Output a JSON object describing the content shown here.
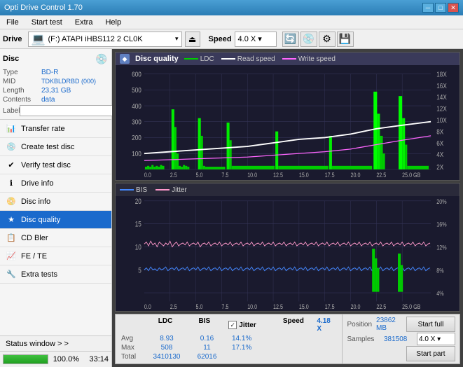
{
  "titlebar": {
    "title": "Opti Drive Control 1.70",
    "min": "─",
    "max": "□",
    "close": "✕"
  },
  "menubar": {
    "items": [
      "File",
      "Start test",
      "Extra",
      "Help"
    ]
  },
  "drive_toolbar": {
    "drive_label": "Drive",
    "drive_value": "(F:)  ATAPI iHBS112  2 CL0K",
    "speed_label": "Speed",
    "speed_value": "4.0 X  ▾"
  },
  "disc_panel": {
    "header": "Disc",
    "rows": [
      {
        "key": "Type",
        "val": "BD-R",
        "blue": true
      },
      {
        "key": "MID",
        "val": "TDKBLDRBD (000)",
        "blue": true
      },
      {
        "key": "Length",
        "val": "23,31 GB",
        "blue": true
      },
      {
        "key": "Contents",
        "val": "data",
        "blue": true
      }
    ],
    "label_key": "Label"
  },
  "nav": {
    "items": [
      {
        "id": "transfer-rate",
        "icon": "📊",
        "label": "Transfer rate",
        "active": false
      },
      {
        "id": "create-test-disc",
        "icon": "💿",
        "label": "Create test disc",
        "active": false
      },
      {
        "id": "verify-test-disc",
        "icon": "✔",
        "label": "Verify test disc",
        "active": false
      },
      {
        "id": "drive-info",
        "icon": "ℹ",
        "label": "Drive info",
        "active": false
      },
      {
        "id": "disc-info",
        "icon": "📀",
        "label": "Disc info",
        "active": false
      },
      {
        "id": "disc-quality",
        "icon": "★",
        "label": "Disc quality",
        "active": true
      },
      {
        "id": "cd-bler",
        "icon": "🔢",
        "label": "CD Bler",
        "active": false
      },
      {
        "id": "fe-te",
        "icon": "📈",
        "label": "FE / TE",
        "active": false
      },
      {
        "id": "extra-tests",
        "icon": "🔧",
        "label": "Extra tests",
        "active": false
      }
    ]
  },
  "status": {
    "window_label": "Status window > >",
    "progress_pct": 100,
    "progress_text": "100.0%",
    "time_text": "33:14"
  },
  "chart1": {
    "title": "Disc quality",
    "legend": [
      {
        "label": "LDC",
        "color": "#00cc00"
      },
      {
        "label": "Read speed",
        "color": "#ffffff"
      },
      {
        "label": "Write speed",
        "color": "#ff66ff"
      }
    ],
    "y_max": 600,
    "y_right_labels": [
      "18X",
      "16X",
      "14X",
      "12X",
      "10X",
      "8X",
      "6X",
      "4X",
      "2X"
    ],
    "x_labels": [
      "0.0",
      "2.5",
      "5.0",
      "7.5",
      "10.0",
      "12.5",
      "15.0",
      "17.5",
      "20.0",
      "22.5",
      "25.0 GB"
    ]
  },
  "chart2": {
    "legend": [
      {
        "label": "BIS",
        "color": "#4488ff"
      },
      {
        "label": "Jitter",
        "color": "#ff99cc"
      }
    ],
    "y_max": 20,
    "y_right_labels": [
      "20%",
      "16%",
      "12%",
      "8%",
      "4%"
    ],
    "x_labels": [
      "0.0",
      "2.5",
      "5.0",
      "7.5",
      "10.0",
      "12.5",
      "15.0",
      "17.5",
      "20.0",
      "22.5",
      "25.0 GB"
    ]
  },
  "stats": {
    "headers": [
      "",
      "LDC",
      "BIS",
      "",
      "Jitter",
      "Speed",
      ""
    ],
    "rows": [
      {
        "label": "Avg",
        "ldc": "8.93",
        "bis": "0.16",
        "jitter": "14.1%"
      },
      {
        "label": "Max",
        "ldc": "508",
        "bis": "11",
        "jitter": "17.1%"
      },
      {
        "label": "Total",
        "ldc": "3410130",
        "bis": "62016",
        "jitter": ""
      }
    ],
    "speed_display": "4.18 X",
    "speed_select": "4.0 X  ▾",
    "position_label": "Position",
    "position_val": "23862 MB",
    "samples_label": "Samples",
    "samples_val": "381508",
    "start_full_label": "Start full",
    "start_part_label": "Start part"
  }
}
